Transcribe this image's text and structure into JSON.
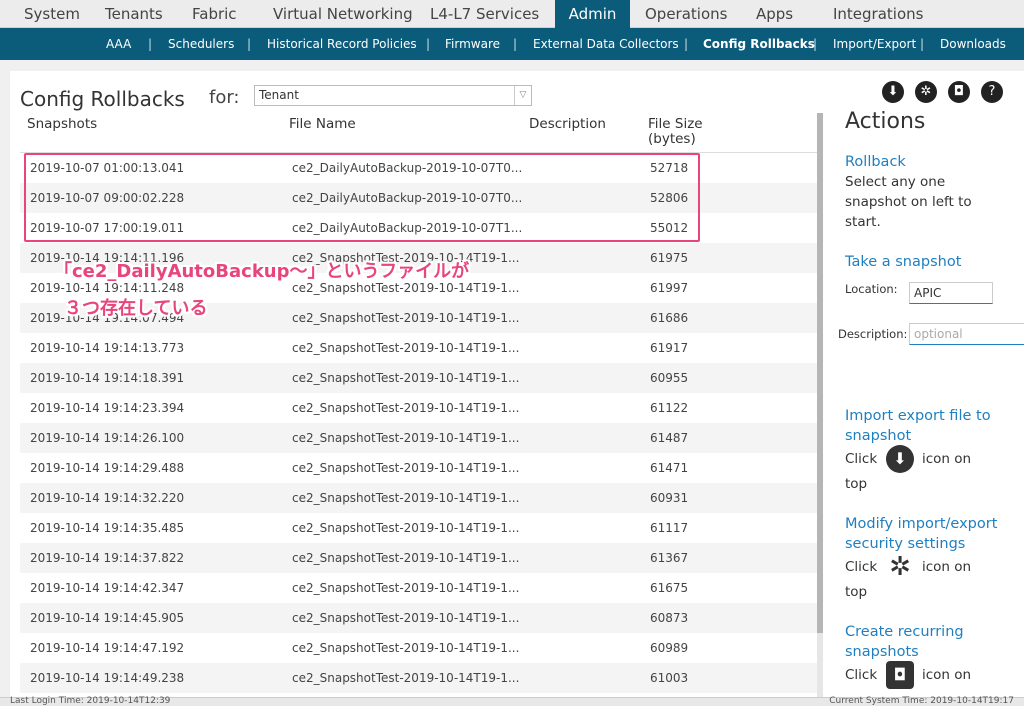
{
  "top_nav": {
    "tabs": [
      "System",
      "Tenants",
      "Fabric",
      "Virtual Networking",
      "L4-L7 Services",
      "Admin",
      "Operations",
      "Apps",
      "Integrations"
    ],
    "active": "Admin"
  },
  "sub_nav": {
    "items": [
      "AAA",
      "Schedulers",
      "Historical Record Policies",
      "Firmware",
      "External Data Collectors",
      "Config Rollbacks",
      "Import/Export",
      "Downloads"
    ],
    "separator": "|",
    "active": "Config Rollbacks"
  },
  "page": {
    "title": "Config Rollbacks",
    "for_label": "for:",
    "tenant_select_value": "Tenant"
  },
  "toolbar_icons": [
    "download-icon",
    "gear-icon",
    "camera-icon",
    "help-icon"
  ],
  "table": {
    "headers": {
      "snapshots": "Snapshots",
      "file_name": "File Name",
      "description": "Description",
      "file_size": "File Size",
      "file_size_unit": "(bytes)"
    },
    "rows": [
      {
        "snapshot": "2019-10-07 01:00:13.041",
        "file": "ce2_DailyAutoBackup-2019-10-07T0...",
        "size": "52718"
      },
      {
        "snapshot": "2019-10-07 09:00:02.228",
        "file": "ce2_DailyAutoBackup-2019-10-07T0...",
        "size": "52806"
      },
      {
        "snapshot": "2019-10-07 17:00:19.011",
        "file": "ce2_DailyAutoBackup-2019-10-07T1...",
        "size": "55012"
      },
      {
        "snapshot": "2019-10-14 19:14:11.196",
        "file": "ce2_SnapshotTest-2019-10-14T19-1...",
        "size": "61975"
      },
      {
        "snapshot": "2019-10-14 19:14:11.248",
        "file": "ce2_SnapshotTest-2019-10-14T19-1...",
        "size": "61997"
      },
      {
        "snapshot": "2019-10-14 19:14:07.494",
        "file": "ce2_SnapshotTest-2019-10-14T19-1...",
        "size": "61686"
      },
      {
        "snapshot": "2019-10-14 19:14:13.773",
        "file": "ce2_SnapshotTest-2019-10-14T19-1...",
        "size": "61917"
      },
      {
        "snapshot": "2019-10-14 19:14:18.391",
        "file": "ce2_SnapshotTest-2019-10-14T19-1...",
        "size": "60955"
      },
      {
        "snapshot": "2019-10-14 19:14:23.394",
        "file": "ce2_SnapshotTest-2019-10-14T19-1...",
        "size": "61122"
      },
      {
        "snapshot": "2019-10-14 19:14:26.100",
        "file": "ce2_SnapshotTest-2019-10-14T19-1...",
        "size": "61487"
      },
      {
        "snapshot": "2019-10-14 19:14:29.488",
        "file": "ce2_SnapshotTest-2019-10-14T19-1...",
        "size": "61471"
      },
      {
        "snapshot": "2019-10-14 19:14:32.220",
        "file": "ce2_SnapshotTest-2019-10-14T19-1...",
        "size": "60931"
      },
      {
        "snapshot": "2019-10-14 19:14:35.485",
        "file": "ce2_SnapshotTest-2019-10-14T19-1...",
        "size": "61117"
      },
      {
        "snapshot": "2019-10-14 19:14:37.822",
        "file": "ce2_SnapshotTest-2019-10-14T19-1...",
        "size": "61367"
      },
      {
        "snapshot": "2019-10-14 19:14:42.347",
        "file": "ce2_SnapshotTest-2019-10-14T19-1...",
        "size": "61675"
      },
      {
        "snapshot": "2019-10-14 19:14:45.905",
        "file": "ce2_SnapshotTest-2019-10-14T19-1...",
        "size": "60873"
      },
      {
        "snapshot": "2019-10-14 19:14:47.192",
        "file": "ce2_SnapshotTest-2019-10-14T19-1...",
        "size": "60989"
      },
      {
        "snapshot": "2019-10-14 19:14:49.238",
        "file": "ce2_SnapshotTest-2019-10-14T19-1...",
        "size": "61003"
      }
    ]
  },
  "annotation": {
    "line1": "「ce2_DailyAutoBackup～」というファイルが",
    "line2": "３つ存在している",
    "color": "#e8457a"
  },
  "actions": {
    "title": "Actions",
    "rollback_link": "Rollback",
    "rollback_desc": [
      "Select any one",
      "snapshot on left to",
      "start."
    ],
    "take_snapshot_link": "Take a snapshot",
    "location_label": "Location:",
    "location_value": "APIC",
    "description_label": "Description:",
    "description_placeholder": "optional",
    "import_export_link": [
      "Import export file to",
      "snapshot"
    ],
    "click_text": "Click",
    "icon_on_text": "icon on",
    "top_text": "top",
    "modify_link": [
      "Modify import/export",
      "security settings"
    ],
    "recurring_link": [
      "Create recurring",
      "snapshots"
    ]
  },
  "status": {
    "last_login": "Last Login Time: 2019-10-14T12:39",
    "current_time": "Current System Time: 2019-10-14T19:17"
  },
  "colors": {
    "nav_active": "#0a5c7a",
    "link": "#1f7fc0",
    "highlight": "#e8457a"
  }
}
